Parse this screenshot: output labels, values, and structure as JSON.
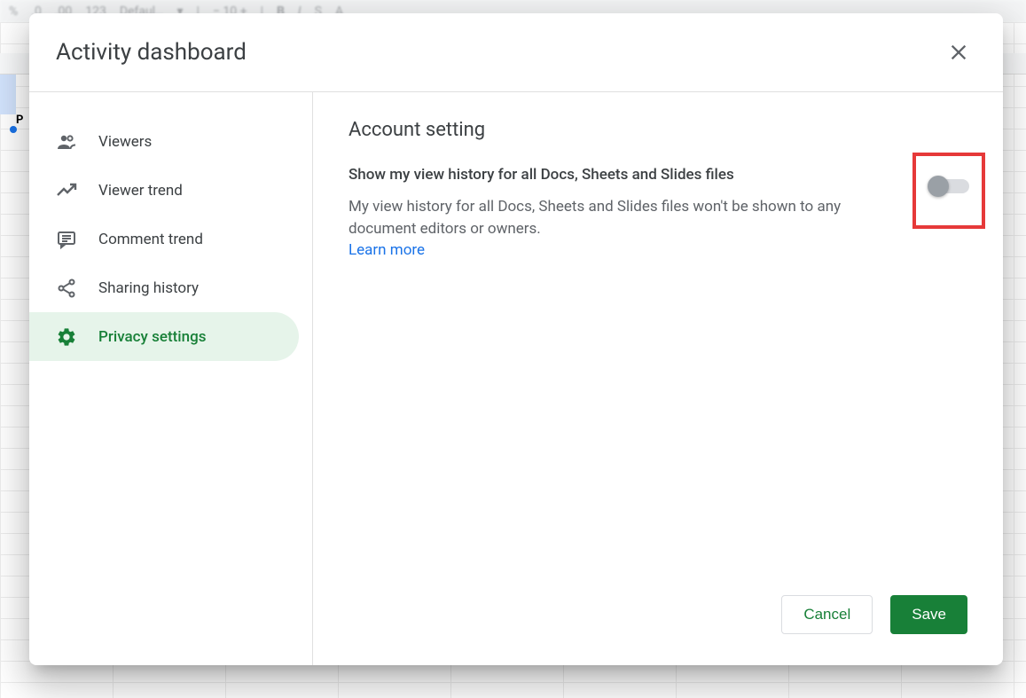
{
  "bg": {
    "cell_text": "P"
  },
  "modal": {
    "title": "Activity dashboard"
  },
  "sidebar": {
    "items": [
      {
        "label": "Viewers"
      },
      {
        "label": "Viewer trend"
      },
      {
        "label": "Comment trend"
      },
      {
        "label": "Sharing history"
      },
      {
        "label": "Privacy settings"
      }
    ]
  },
  "content": {
    "section_title": "Account setting",
    "setting_label": "Show my view history for all Docs, Sheets and Slides files",
    "setting_desc": "My view history for all Docs, Sheets and Slides files won't be shown to any document editors or owners.",
    "learn_more": "Learn more"
  },
  "footer": {
    "cancel": "Cancel",
    "save": "Save"
  }
}
